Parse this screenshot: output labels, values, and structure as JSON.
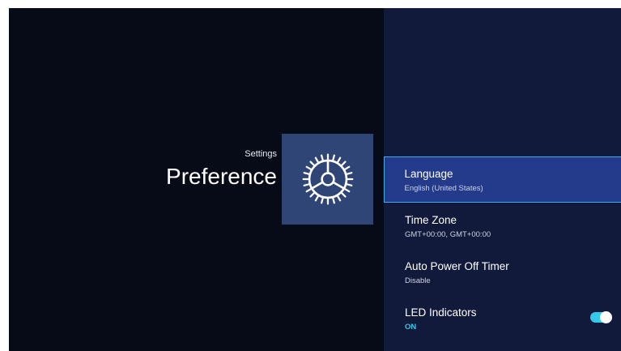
{
  "header": {
    "caption": "Settings",
    "title": "Preference"
  },
  "category_icon": "gear-icon",
  "menu": {
    "items": [
      {
        "title": "Language",
        "value": "English (United States)",
        "selected": true
      },
      {
        "title": "Time Zone",
        "value": "GMT+00:00, GMT+00:00"
      },
      {
        "title": "Auto Power Off Timer",
        "value": "Disable"
      },
      {
        "title": "LED Indicators",
        "value": "ON",
        "toggle": true
      }
    ]
  },
  "colors": {
    "background": "#070a17",
    "panel": "#111a3a",
    "tile": "#2e4576",
    "selected": "#243a8a",
    "accent": "#35c8ea"
  }
}
